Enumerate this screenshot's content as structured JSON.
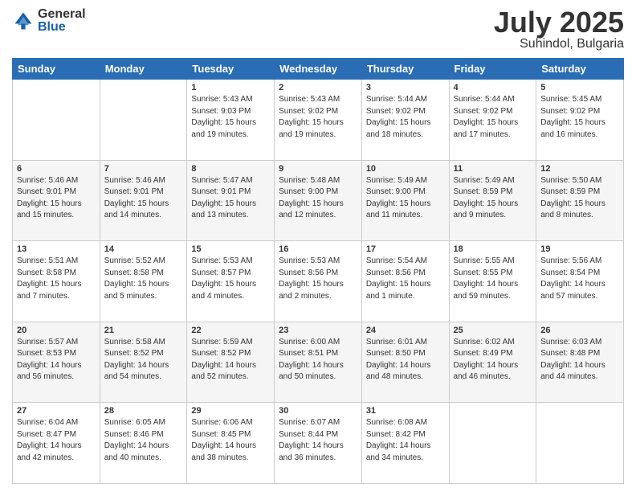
{
  "logo": {
    "general": "General",
    "blue": "Blue"
  },
  "header": {
    "month": "July 2025",
    "location": "Suhindol, Bulgaria"
  },
  "weekdays": [
    "Sunday",
    "Monday",
    "Tuesday",
    "Wednesday",
    "Thursday",
    "Friday",
    "Saturday"
  ],
  "weeks": [
    [
      {
        "day": null,
        "info": null
      },
      {
        "day": null,
        "info": null
      },
      {
        "day": "1",
        "info": "Sunrise: 5:43 AM\nSunset: 9:03 PM\nDaylight: 15 hours\nand 19 minutes."
      },
      {
        "day": "2",
        "info": "Sunrise: 5:43 AM\nSunset: 9:02 PM\nDaylight: 15 hours\nand 19 minutes."
      },
      {
        "day": "3",
        "info": "Sunrise: 5:44 AM\nSunset: 9:02 PM\nDaylight: 15 hours\nand 18 minutes."
      },
      {
        "day": "4",
        "info": "Sunrise: 5:44 AM\nSunset: 9:02 PM\nDaylight: 15 hours\nand 17 minutes."
      },
      {
        "day": "5",
        "info": "Sunrise: 5:45 AM\nSunset: 9:02 PM\nDaylight: 15 hours\nand 16 minutes."
      }
    ],
    [
      {
        "day": "6",
        "info": "Sunrise: 5:46 AM\nSunset: 9:01 PM\nDaylight: 15 hours\nand 15 minutes."
      },
      {
        "day": "7",
        "info": "Sunrise: 5:46 AM\nSunset: 9:01 PM\nDaylight: 15 hours\nand 14 minutes."
      },
      {
        "day": "8",
        "info": "Sunrise: 5:47 AM\nSunset: 9:01 PM\nDaylight: 15 hours\nand 13 minutes."
      },
      {
        "day": "9",
        "info": "Sunrise: 5:48 AM\nSunset: 9:00 PM\nDaylight: 15 hours\nand 12 minutes."
      },
      {
        "day": "10",
        "info": "Sunrise: 5:49 AM\nSunset: 9:00 PM\nDaylight: 15 hours\nand 11 minutes."
      },
      {
        "day": "11",
        "info": "Sunrise: 5:49 AM\nSunset: 8:59 PM\nDaylight: 15 hours\nand 9 minutes."
      },
      {
        "day": "12",
        "info": "Sunrise: 5:50 AM\nSunset: 8:59 PM\nDaylight: 15 hours\nand 8 minutes."
      }
    ],
    [
      {
        "day": "13",
        "info": "Sunrise: 5:51 AM\nSunset: 8:58 PM\nDaylight: 15 hours\nand 7 minutes."
      },
      {
        "day": "14",
        "info": "Sunrise: 5:52 AM\nSunset: 8:58 PM\nDaylight: 15 hours\nand 5 minutes."
      },
      {
        "day": "15",
        "info": "Sunrise: 5:53 AM\nSunset: 8:57 PM\nDaylight: 15 hours\nand 4 minutes."
      },
      {
        "day": "16",
        "info": "Sunrise: 5:53 AM\nSunset: 8:56 PM\nDaylight: 15 hours\nand 2 minutes."
      },
      {
        "day": "17",
        "info": "Sunrise: 5:54 AM\nSunset: 8:56 PM\nDaylight: 15 hours\nand 1 minute."
      },
      {
        "day": "18",
        "info": "Sunrise: 5:55 AM\nSunset: 8:55 PM\nDaylight: 14 hours\nand 59 minutes."
      },
      {
        "day": "19",
        "info": "Sunrise: 5:56 AM\nSunset: 8:54 PM\nDaylight: 14 hours\nand 57 minutes."
      }
    ],
    [
      {
        "day": "20",
        "info": "Sunrise: 5:57 AM\nSunset: 8:53 PM\nDaylight: 14 hours\nand 56 minutes."
      },
      {
        "day": "21",
        "info": "Sunrise: 5:58 AM\nSunset: 8:52 PM\nDaylight: 14 hours\nand 54 minutes."
      },
      {
        "day": "22",
        "info": "Sunrise: 5:59 AM\nSunset: 8:52 PM\nDaylight: 14 hours\nand 52 minutes."
      },
      {
        "day": "23",
        "info": "Sunrise: 6:00 AM\nSunset: 8:51 PM\nDaylight: 14 hours\nand 50 minutes."
      },
      {
        "day": "24",
        "info": "Sunrise: 6:01 AM\nSunset: 8:50 PM\nDaylight: 14 hours\nand 48 minutes."
      },
      {
        "day": "25",
        "info": "Sunrise: 6:02 AM\nSunset: 8:49 PM\nDaylight: 14 hours\nand 46 minutes."
      },
      {
        "day": "26",
        "info": "Sunrise: 6:03 AM\nSunset: 8:48 PM\nDaylight: 14 hours\nand 44 minutes."
      }
    ],
    [
      {
        "day": "27",
        "info": "Sunrise: 6:04 AM\nSunset: 8:47 PM\nDaylight: 14 hours\nand 42 minutes."
      },
      {
        "day": "28",
        "info": "Sunrise: 6:05 AM\nSunset: 8:46 PM\nDaylight: 14 hours\nand 40 minutes."
      },
      {
        "day": "29",
        "info": "Sunrise: 6:06 AM\nSunset: 8:45 PM\nDaylight: 14 hours\nand 38 minutes."
      },
      {
        "day": "30",
        "info": "Sunrise: 6:07 AM\nSunset: 8:44 PM\nDaylight: 14 hours\nand 36 minutes."
      },
      {
        "day": "31",
        "info": "Sunrise: 6:08 AM\nSunset: 8:42 PM\nDaylight: 14 hours\nand 34 minutes."
      },
      {
        "day": null,
        "info": null
      },
      {
        "day": null,
        "info": null
      }
    ]
  ]
}
